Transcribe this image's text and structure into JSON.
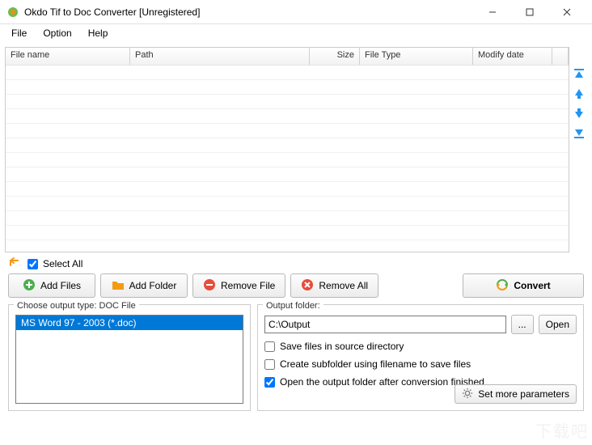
{
  "window": {
    "title": "Okdo Tif to Doc Converter [Unregistered]"
  },
  "menu": {
    "file": "File",
    "option": "Option",
    "help": "Help"
  },
  "columns": {
    "filename": "File name",
    "path": "Path",
    "size": "Size",
    "filetype": "File Type",
    "modify": "Modify date"
  },
  "selectall": "Select All",
  "buttons": {
    "addfiles": "Add Files",
    "addfolder": "Add Folder",
    "removefile": "Remove File",
    "removeall": "Remove All",
    "convert": "Convert",
    "browse": "...",
    "open": "Open",
    "moreparams": "Set more parameters"
  },
  "outputtype": {
    "label": "Choose output type:  DOC File",
    "option1": "MS Word 97 - 2003 (*.doc)"
  },
  "outputfolder": {
    "label": "Output folder:",
    "value": "C:\\Output"
  },
  "checks": {
    "savesource": "Save files in source directory",
    "subfolder": "Create subfolder using filename to save files",
    "openafter": "Open the output folder after conversion finished"
  },
  "checkstate": {
    "selectall": true,
    "savesource": false,
    "subfolder": false,
    "openafter": true
  },
  "colwidths": {
    "filename": 154,
    "path": 222,
    "size": 62,
    "filetype": 140,
    "modify": 98,
    "blank": 20
  }
}
